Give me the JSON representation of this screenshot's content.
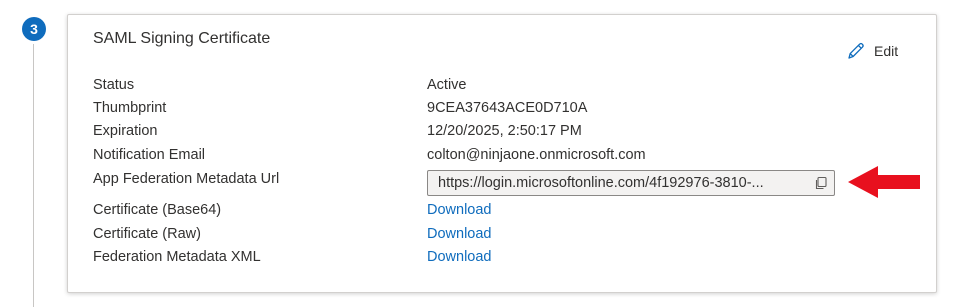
{
  "step": {
    "number": "3"
  },
  "card": {
    "title": "SAML Signing Certificate",
    "edit_label": "Edit",
    "rows": [
      {
        "label": "Status",
        "value": "Active"
      },
      {
        "label": "Thumbprint",
        "value": "9CEA37643ACE0D710A"
      },
      {
        "label": "Expiration",
        "value": "12/20/2025, 2:50:17 PM"
      },
      {
        "label": "Notification Email",
        "value": "colton@ninjaone.onmicrosoft.com"
      },
      {
        "label": "App Federation Metadata Url",
        "value": "https://login.microsoftonline.com/4f192976-3810-..."
      },
      {
        "label": "Certificate (Base64)",
        "value": "Download"
      },
      {
        "label": "Certificate (Raw)",
        "value": "Download"
      },
      {
        "label": "Federation Metadata XML",
        "value": "Download"
      }
    ]
  },
  "colors": {
    "accent": "#0f6cbd",
    "annotation_arrow": "#e8101e"
  },
  "icons": {
    "edit": "pencil-icon",
    "copy": "copy-icon",
    "annotation": "left-arrow-icon"
  }
}
